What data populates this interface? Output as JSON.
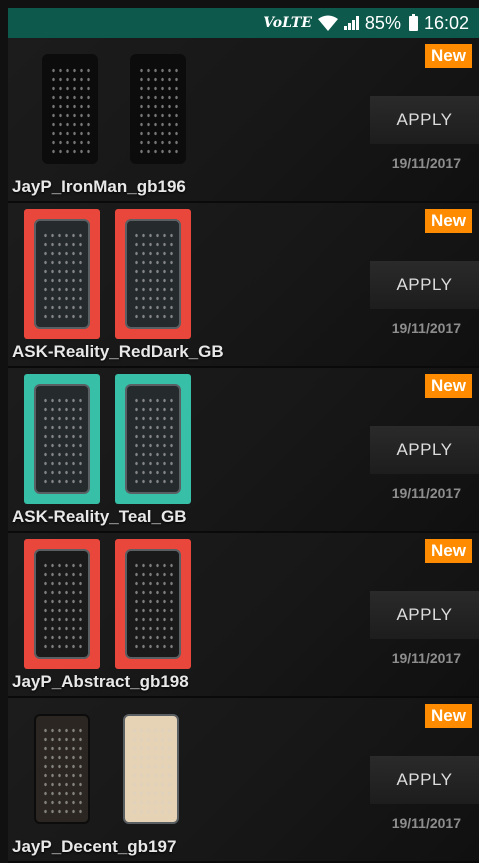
{
  "status_bar": {
    "network": "VoLTE",
    "battery": "85%",
    "time": "16:02"
  },
  "themes": [
    {
      "name": "JayP_IronMan_gb196",
      "badge": "New",
      "apply_label": "APPLY",
      "date": "19/11/2017"
    },
    {
      "name": "ASK-Reality_RedDark_GB",
      "badge": "New",
      "apply_label": "APPLY",
      "date": "19/11/2017"
    },
    {
      "name": "ASK-Reality_Teal_GB",
      "badge": "New",
      "apply_label": "APPLY",
      "date": "19/11/2017"
    },
    {
      "name": "JayP_Abstract_gb198",
      "badge": "New",
      "apply_label": "APPLY",
      "date": "19/11/2017"
    },
    {
      "name": "JayP_Decent_gb197",
      "badge": "New",
      "apply_label": "APPLY",
      "date": "19/11/2017"
    }
  ],
  "colors": {
    "status_bar": "#0d5a4d",
    "badge": "#ff8c00",
    "red_preview": "#e9473b",
    "teal_preview": "#37bfa8"
  }
}
